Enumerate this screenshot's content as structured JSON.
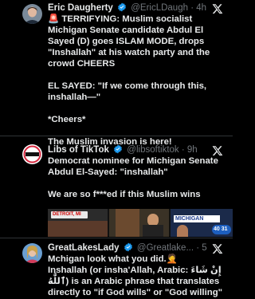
{
  "posts": [
    {
      "author": "Eric Daugherty",
      "handle": "@EricLDaugh",
      "time": "· 4h",
      "paragraphs": [
        "🚨 TERRIFYING: Muslim socialist Michigan Senate candidate Abdul El Sayed (D) goes ISLAM MODE, drops \"Inshallah\" at his watch party and the crowd CHEERS",
        "EL SAYED: \"If we come through this, inshallah—\"",
        "*Cheers*",
        "The Muslim invasion is here!"
      ]
    },
    {
      "author": "Libs of TikTok",
      "handle": "@libsoftiktok",
      "time": "· 9h",
      "paragraphs": [
        "Democrat nominee for Michigan Senate Abdul El-Sayed: \"inshallah\"",
        "We are so f***ed if this Muslim wins"
      ],
      "media_text": {
        "location": "DETROIT, MI",
        "banner": "MICHIGAN",
        "score": "40 31"
      },
      "avatar_text": "Libs of TikTok"
    },
    {
      "author": "GreatLakesLady",
      "handle": "@Greatlake...",
      "time": "· 5h",
      "paragraphs": [
        "Mchigan look what you did.🤦",
        "Inshallah (or insha'Allah, Arabic: إِنْ شَاءَ ٱللَّٰهُ) is an Arabic phrase that translates directly to \"if God wills\" or \"God willing\""
      ]
    }
  ],
  "colors": {
    "background": "#000000",
    "text": "#e7e9ea",
    "muted": "#71767b",
    "verified": "#1d9bf0"
  }
}
